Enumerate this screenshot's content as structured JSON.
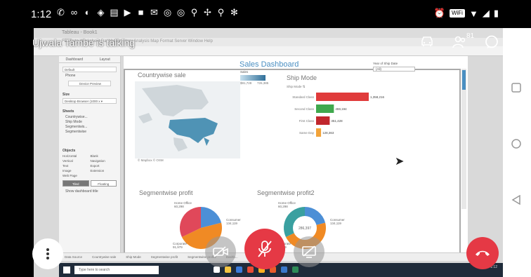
{
  "status_bar": {
    "time": "1:12",
    "wifi_badge": "WiFi"
  },
  "call": {
    "talker": "Ujwala Tambe is talking",
    "participant_count": "81"
  },
  "window": {
    "title": "Tableau - Book1",
    "menu": "File  Data  Worksheet  Dashboard  Story  Analysis  Map  Format  Server  Window  Help"
  },
  "left_pane": {
    "tabs": [
      "Dashboard",
      "Layout"
    ],
    "device_preview": {
      "items": [
        "Default",
        "Phone"
      ],
      "button": "Device Preview"
    },
    "size": {
      "label": "Size",
      "value": "Desktop Browser (1000 x ▾"
    },
    "sheets": {
      "label": "Sheets",
      "items": [
        "Countrywise...",
        "Ship Mode",
        "Segmentwis...",
        "Segmentwise"
      ]
    },
    "objects": {
      "label": "Objects",
      "items": [
        "Horizontal",
        "Blank",
        "Vertical",
        "Navigation",
        "Text",
        "Export",
        "Image",
        "Extension",
        "Web Page",
        ""
      ]
    },
    "buttons": [
      "Tiled",
      "Floating"
    ],
    "checkbox": "Show dashboard title"
  },
  "dashboard": {
    "title": "Sales Dashboard",
    "country_title": "Countrywise sale",
    "map_credit": "© Mapbox © OSM",
    "sales_legend": {
      "label": "Sales",
      "min": "$91,728",
      "max": "726,385"
    },
    "ship_title": "Ship Mode",
    "ship_axis": "Ship Mode ⇅",
    "year_filter": {
      "label": "Year of Ship Date",
      "value": "(All)"
    },
    "segment_title": "Segmentwise profit",
    "segment2_title": "Segmentwise profit2"
  },
  "chart_data": [
    {
      "type": "bar",
      "title": "Ship Mode",
      "categories": [
        "Standard Class",
        "Second Class",
        "First Class",
        "Same Day"
      ],
      "values": [
        1358216,
        459194,
        351428,
        128363
      ],
      "labels": [
        "1,358,216",
        "459,194",
        "351,428",
        "128,363"
      ],
      "colors": [
        "#e03b3b",
        "#3fa84d",
        "#c1272d",
        "#f2a33a"
      ]
    },
    {
      "type": "pie",
      "title": "Segmentwise profit",
      "categories": [
        "Home Office",
        "Consumer",
        "Corporate"
      ],
      "values": [
        60298,
        134119,
        91979
      ],
      "labels": [
        "Home Office\n60,298",
        "Consumer\n134,119",
        "Corporate\n91,979"
      ],
      "colors": [
        "#4c8fd6",
        "#f08a24",
        "#e0485a"
      ]
    },
    {
      "type": "pie",
      "title": "Segmentwise profit2",
      "categories": [
        "Home Office",
        "Consumer",
        "Corporate"
      ],
      "values": [
        60298,
        134119,
        91979
      ],
      "center_label": "286,397",
      "labels": [
        "Home Office\n60,298",
        "Consumer\n134,119",
        "Corporate\n91,979"
      ],
      "colors": [
        "#4c8fd6",
        "#f08a24",
        "#3aa0a0"
      ]
    }
  ],
  "sheet_tabs": [
    "Data Source",
    "Countrywise sale",
    "Ship Mode",
    "Segmentwise profit",
    "Segmentwise profit2",
    "Dashb..."
  ],
  "taskbar": {
    "search": "Type here to search",
    "time": "1:12",
    "date": ""
  },
  "nav_icons": [
    "square-icon",
    "circle-icon",
    "triangle-icon"
  ]
}
